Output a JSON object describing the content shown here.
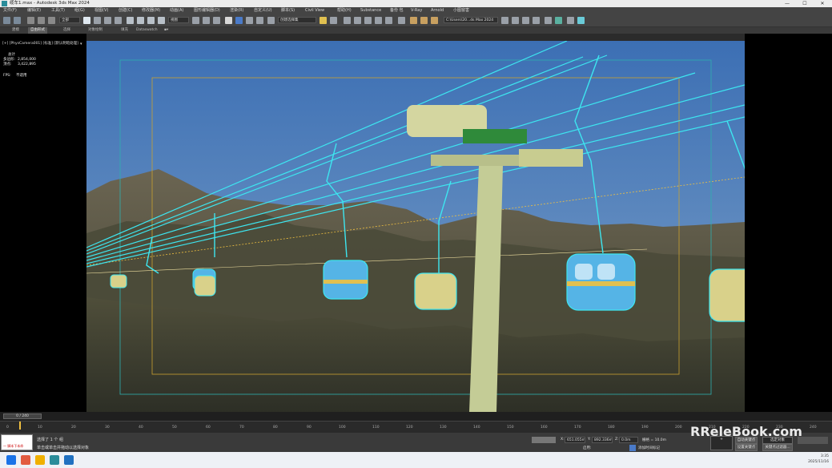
{
  "window": {
    "title": "缆车1.max - Autodesk 3ds Max 2024",
    "minimize": "—",
    "maximize": "☐",
    "close": "✕"
  },
  "menu": [
    "文件(F)",
    "编辑(E)",
    "工具(T)",
    "组(G)",
    "视图(V)",
    "创建(C)",
    "修改器(M)",
    "动画(A)",
    "图形编辑器(D)",
    "渲染(R)",
    "自定义(U)",
    "脚本(S)",
    "Civil View",
    "帮助(H)",
    "Substance",
    "备份 包",
    "V-Ray",
    "Arnold",
    "小图窗害"
  ],
  "toolbar": {
    "selection_filter": "全部",
    "reference_coord": "视图",
    "named_selection": "创建选择集",
    "workspace_path": "C:\\Users\\20...ds Max 2024"
  },
  "ribbon": {
    "tabs": [
      "建模",
      "自由形式",
      "选择",
      "对象绘制",
      "填充",
      "Dataswatch"
    ],
    "active_tab": "自由形式"
  },
  "viewport": {
    "label": "[+] [PhysCamera001] [标准] [默认明暗处理]",
    "stats": {
      "title": "总计",
      "polys_label": "多边形:",
      "polys": "2,854,000",
      "verts_label": "顶点:",
      "verts": "3,422,895",
      "fps_label": "FPS:",
      "fps": "不适用"
    }
  },
  "timeline": {
    "frame_display": "0 / 240",
    "ticks": [
      "0",
      "10",
      "20",
      "30",
      "40",
      "50",
      "60",
      "70",
      "80",
      "90",
      "100",
      "110",
      "120",
      "130",
      "140",
      "150",
      "160",
      "170",
      "180",
      "190",
      "200",
      "210",
      "220",
      "230",
      "240"
    ]
  },
  "status": {
    "maxscript_error": "一 脚本下本命",
    "selected_label": "选择了 1 个 组",
    "prompt": "单击或单击并拖动以选择对象",
    "x_label": "X:",
    "x_value": "651.055m",
    "y_label": "Y:",
    "y_value": "892.336m",
    "z_label": "Z:",
    "z_value": "0.0m",
    "grid": "栅格 = 10.0m",
    "add_time_tag": "添加时间标记",
    "auto_key": "自动关键点",
    "set_key": "设置关键点",
    "selected_object": "选定对象",
    "key_filters": "关键点过滤器...",
    "enabled_label": "启用:"
  },
  "taskbar": {
    "time": "3:35",
    "date": "2025/11/16"
  },
  "watermark": "RReleBook.com",
  "colors": {
    "sky": "#4a78b8",
    "wire_cyan": "#3de6f0",
    "tower": "#cfd7a0",
    "cabin_blue": "#55b4e6",
    "cabin_yellow": "#d9d18a",
    "accent_green": "#2f8a3a"
  }
}
